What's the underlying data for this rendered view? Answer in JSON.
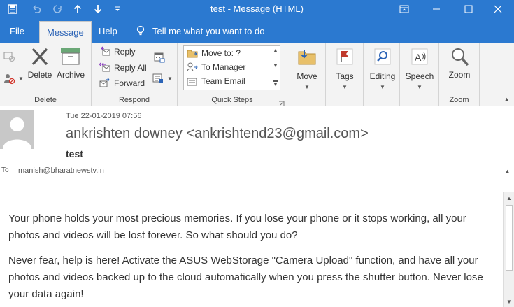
{
  "window": {
    "title": "test  -  Message (HTML)"
  },
  "colors": {
    "titlebar": "#2b79d0",
    "ribbon": "#f3f3f3",
    "accent_blue": "#2b63b6",
    "flag_red": "#c0392b"
  },
  "tabs": [
    {
      "label": "File"
    },
    {
      "label": "Message"
    },
    {
      "label": "Help"
    },
    {
      "label": "Tell me what you want to do"
    }
  ],
  "ribbon": {
    "delete_group": {
      "label": "Delete",
      "delete": "Delete",
      "archive": "Archive"
    },
    "respond_group": {
      "label": "Respond",
      "reply": "Reply",
      "reply_all": "Reply All",
      "forward": "Forward"
    },
    "quick_steps_group": {
      "label": "Quick Steps",
      "items": [
        "Move to: ?",
        "To Manager",
        "Team Email"
      ]
    },
    "move": "Move",
    "tags": "Tags",
    "editing": "Editing",
    "speech": "Speech",
    "zoom_group": {
      "label": "Zoom",
      "zoom": "Zoom"
    }
  },
  "message": {
    "date": "Tue 22-01-2019 07:56",
    "sender": "ankrishten downey <ankrishtend23@gmail.com>",
    "subject": "test",
    "to_label": "To",
    "to": "manish@bharatnewstv.in",
    "paragraphs": [
      "Your phone holds your most precious memories. If you lose your phone or it stops working, all your photos and videos will be lost forever. So what should you do?",
      "Never fear, help is here! Activate the ASUS WebStorage \"Camera Upload\" function, and have all your photos and videos backed up to the cloud automatically when you press the shutter button. Never lose your data again!"
    ]
  }
}
